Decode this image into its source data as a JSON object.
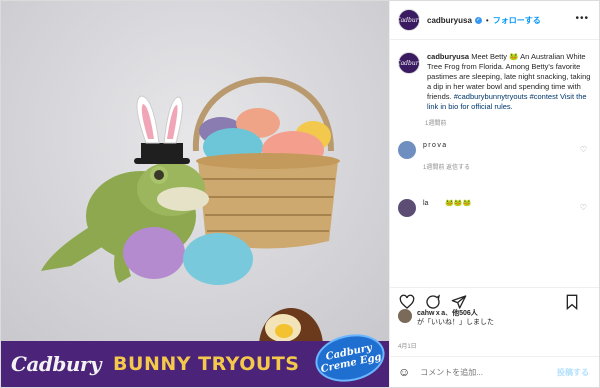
{
  "account": {
    "username": "cadburyusa",
    "follow_label": "フォローする",
    "avatar_text": "Cadbury"
  },
  "promo": {
    "logo": "Cadbury",
    "title": "BUNNY TRYOUTS",
    "egg_badge": "Cadbury Creme Egg"
  },
  "caption": {
    "username": "cadburyusa",
    "text": "Meet Betty 🐸 An Australian White Tree Frog from Florida. Among Betty's favorite pastimes are sleeping, late night snacking, taking a dip in her water bowl and spending time with friends.",
    "tags": "#cadburybunnytryouts #contest Visit the link in bio for official rules.",
    "time": "1週間前"
  },
  "comments": [
    {
      "line1": "p r o v a             ",
      "line2": "　",
      "meta": "1週間前 返信する"
    },
    {
      "line1": "la          🐸🐸🐸",
      "line2": "",
      "meta": ""
    }
  ],
  "likes": {
    "count": "他506人",
    "text": "が「いいね！」しました",
    "user": "cahw x a"
  },
  "date": "4月1日",
  "compose": {
    "placeholder": "コメントを追加...",
    "post_label": "投稿する"
  },
  "colors": {
    "promo_purple": "#4b2379",
    "promo_yellow": "#f4c94b",
    "link_blue": "#0095f6"
  }
}
